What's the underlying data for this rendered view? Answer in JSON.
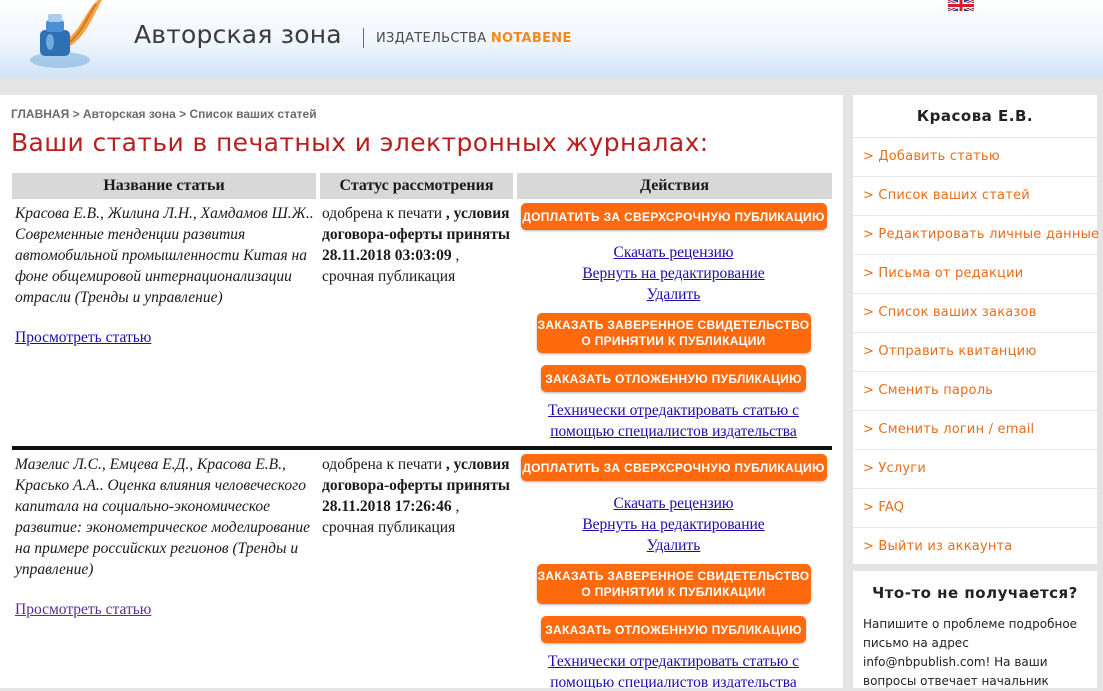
{
  "header": {
    "brand": "Авторская зона",
    "publisher_prefix": "ИЗДАТЕЛЬСТВА",
    "publisher_name": "NOTABENE"
  },
  "breadcrumb": {
    "home": "ГЛАВНАЯ",
    "sep": ">",
    "zone": "Авторская зона",
    "current": "Список ваших статей"
  },
  "page_title": "Ваши статьи в печатных и электронных журналах:",
  "table": {
    "headers": [
      "Название статьи",
      "Статус рассмотрения",
      "Действия"
    ],
    "rows": [
      {
        "title": "Красова Е.В., Жилина Л.Н., Хамдамов Ш.Ж.. Современные тенденции развития автомобильной промышленности Китая на фоне общемировой интернационализации отрасли (Тренды и управление)",
        "view": "Просмотреть статью",
        "status_plain1": "одобрена к печати",
        "status_bold": ", условия договора-оферты приняты 28.11.2018 03:03:09",
        "status_plain2": ", срочная публикация",
        "actions": {
          "urgent": "ДОПЛАТИТЬ ЗА СВЕРХСРОЧНУЮ ПУБЛИКАЦИЮ",
          "review": "Скачать рецензию",
          "return": "Вернуть на редактирование",
          "delete": "Удалить",
          "cert_line1": "ЗАКАЗАТЬ ЗАВЕРЕННОЕ СВИДЕТЕЛЬСТВО",
          "cert_line2": "О ПРИНЯТИИ К ПУБЛИКАЦИИ",
          "deferred": "ЗАКАЗАТЬ ОТЛОЖЕННУЮ ПУБЛИКАЦИЮ",
          "tech_edit": "Технически отредактировать статью с помощью специалистов издательства"
        }
      },
      {
        "title": "Мазелис Л.С., Емцева Е.Д., Красова Е.В., Красько А.А.. Оценка влияния человеческого капитала на социально-экономическое развитие: эконометрическое моделирование на примере российских регионов (Тренды и управление)",
        "view": "Просмотреть статью",
        "status_plain1": "одобрена к печати",
        "status_bold": ", условия договора-оферты приняты 28.11.2018 17:26:46",
        "status_plain2": ", срочная публикация",
        "actions": {
          "urgent": "ДОПЛАТИТЬ ЗА СВЕРХСРОЧНУЮ ПУБЛИКАЦИЮ",
          "review": "Скачать рецензию",
          "return": "Вернуть на редактирование",
          "delete": "Удалить",
          "cert_line1": "ЗАКАЗАТЬ ЗАВЕРЕННОЕ СВИДЕТЕЛЬСТВО",
          "cert_line2": "О ПРИНЯТИИ К ПУБЛИКАЦИИ",
          "deferred": "ЗАКАЗАТЬ ОТЛОЖЕННУЮ ПУБЛИКАЦИЮ",
          "tech_edit": "Технически отредактировать статью с помощью специалистов издательства"
        }
      }
    ]
  },
  "sidebar": {
    "user": "Красова Е.В.",
    "items": [
      "> Добавить статью",
      "> Список ваших статей",
      "> Редактировать личные данные",
      "> Письма от редакции",
      "> Список ваших заказов",
      "> Отправить квитанцию",
      "> Сменить пароль",
      "> Сменить логин / email",
      "> Услуги",
      "> FAQ",
      "> Выйти из аккаунта"
    ]
  },
  "help": {
    "title": "Что-то не получается?",
    "text": "Напишите о проблеме подробное письмо на адрес info@nbpublish.com! На ваши вопросы отвечает начальник"
  },
  "colors": {
    "accent_orange": "#ff6a0f",
    "title_red": "#b82020",
    "menu_orange": "#e86d1a",
    "link_blue": "#1a0dab"
  }
}
